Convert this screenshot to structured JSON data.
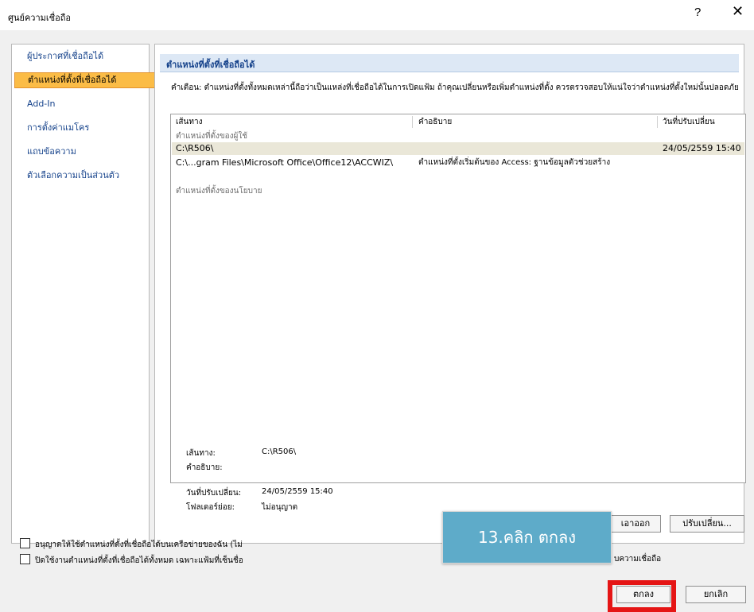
{
  "window": {
    "title": "ศูนย์ความเชื่อถือ",
    "help_glyph": "?",
    "close_glyph": "✕"
  },
  "sidebar": {
    "items": [
      {
        "label": "ผู้ประกาศที่เชื่อถือได้",
        "active": false
      },
      {
        "label": "ตำแหน่งที่ตั้งที่เชื่อถือได้",
        "active": true
      },
      {
        "label": "Add-In",
        "active": false
      },
      {
        "label": "การตั้งค่าแมโคร",
        "active": false
      },
      {
        "label": "แถบข้อความ",
        "active": false
      },
      {
        "label": "ตัวเลือกความเป็นส่วนตัว",
        "active": false
      }
    ]
  },
  "main": {
    "section_title": "ตำแหน่งที่ตั้งที่เชื่อถือได้",
    "warning": "คำเตือน: ตำแหน่งที่ตั้งทั้งหมดเหล่านี้ถือว่าเป็นแหล่งที่เชื่อถือได้ในการเปิดแฟ้ม ถ้าคุณเปลี่ยนหรือเพิ่มตำแหน่งที่ตั้ง ควรตรวจสอบให้แน่ใจว่าตำแหน่งที่ตั้งใหม่นั้นปลอดภัย",
    "table": {
      "headers": [
        "เส้นทาง",
        "คำอธิบาย",
        "วันที่ปรับเปลี่ยน"
      ],
      "user_group": "ตำแหน่งที่ตั้งของผู้ใช้",
      "rows": [
        {
          "path": "C:\\R506\\",
          "description": "",
          "modified": "24/05/2559 15:40",
          "selected": true
        },
        {
          "path": "C:\\...gram Files\\Microsoft Office\\Office12\\ACCWIZ\\",
          "description": "ตำแหน่งที่ตั้งเริ่มต้นของ Access: ฐานข้อมูลตัวช่วยสร้าง",
          "modified": "",
          "selected": false
        }
      ],
      "policy_group": "ตำแหน่งที่ตั้งของนโยบาย"
    },
    "details": {
      "path_label": "เส้นทาง:",
      "path_value": "C:\\R506\\",
      "description_label": "คำอธิบาย:",
      "modified_label": "วันที่ปรับเปลี่ยน:",
      "modified_value": "24/05/2559 15:40",
      "subfolders_label": "โฟลเดอร์ย่อย:",
      "subfolders_value": "ไม่อนุญาต"
    },
    "buttons": {
      "remove": "เอาออก",
      "modify": "ปรับเปลี่ยน..."
    },
    "checkboxes": [
      {
        "label": "อนุญาตให้ใช้ตำแหน่งที่ตั้งที่เชื่อถือได้บนเครือข่ายของฉัน (ไม่",
        "checked": false
      },
      {
        "label": "ปิดใช้งานตำแหน่งที่ตั้งที่เชื่อถือได้ทั้งหมด เฉพาะแฟ้มที่เซ็นชื่อ",
        "checked": false
      }
    ],
    "checkbox2_tail": "บความเชื่อถือ"
  },
  "footer": {
    "ok": "ตกลง",
    "cancel": "ยกเลิก"
  },
  "annotation": {
    "tooltip": "13.คลิก ตกลง",
    "tooltip_color": "#5eabc9",
    "highlight_color": "#e51515"
  }
}
